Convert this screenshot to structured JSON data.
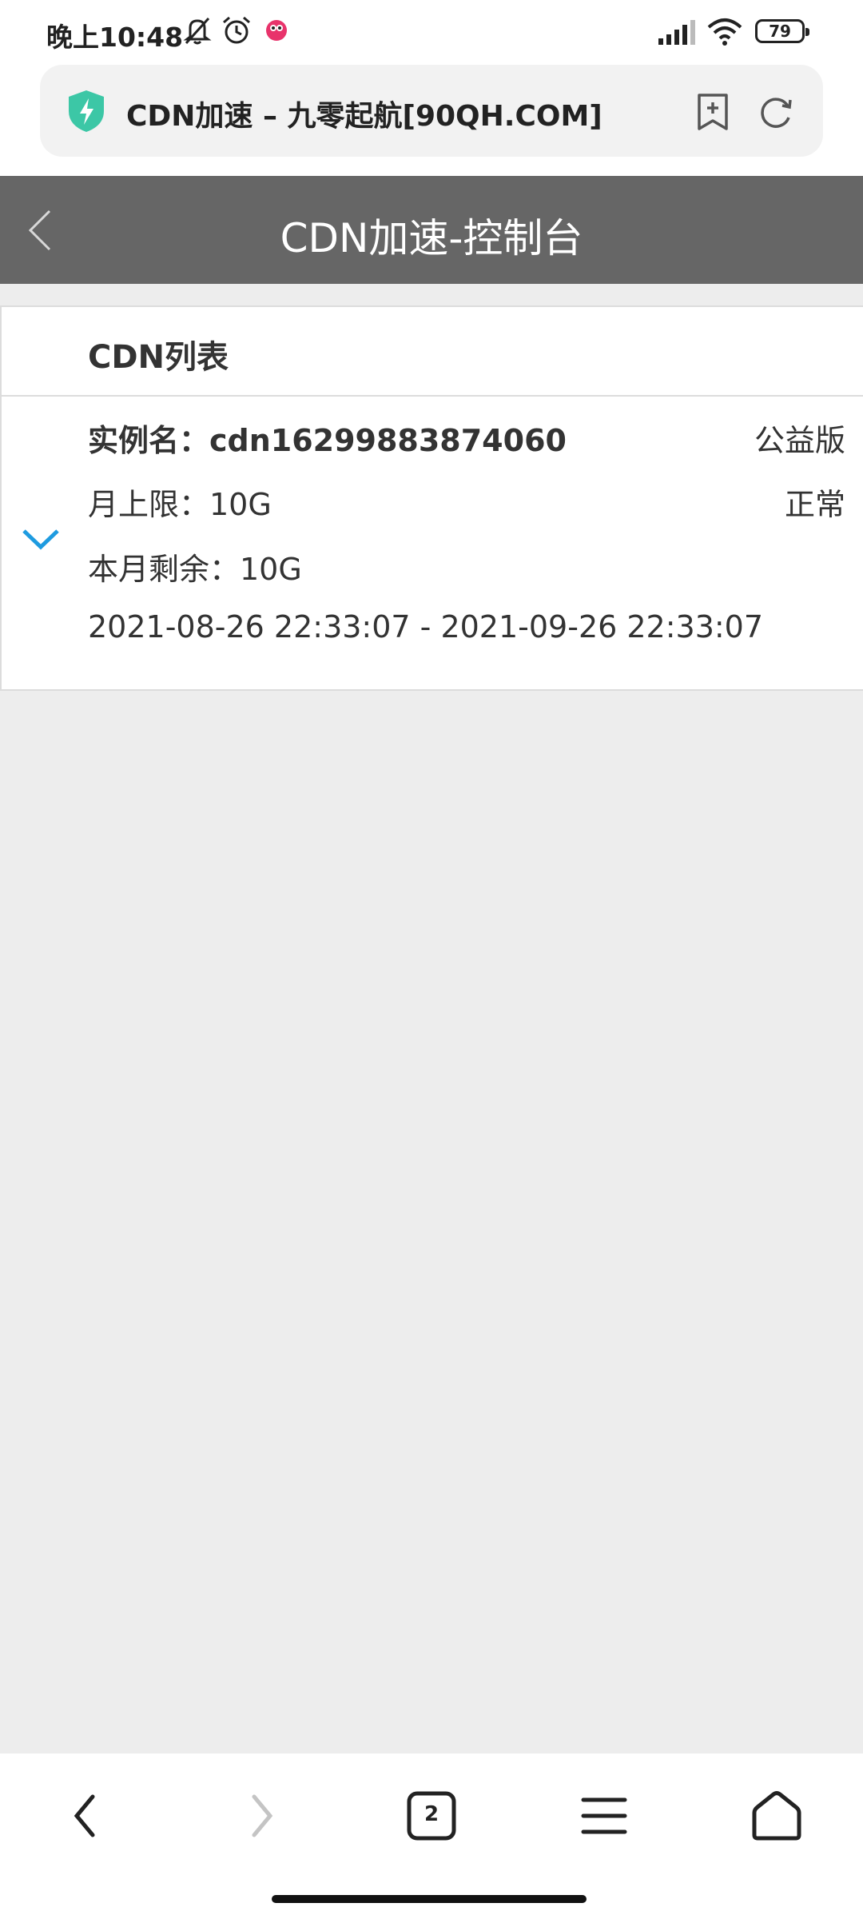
{
  "status_bar": {
    "time": "晚上10:48",
    "icons": [
      "bell-off-icon",
      "alarm-icon",
      "app-notification-icon",
      "signal-icon",
      "wifi-icon"
    ],
    "battery": "79"
  },
  "browser": {
    "tab_title": "CDN加速 – 九零起航[90QH.COM]",
    "icons": [
      "shield-icon",
      "add-bookmark-icon",
      "reload-icon"
    ],
    "accent_color": "#3cc7a6"
  },
  "header": {
    "title": "CDN加速-控制台",
    "background": "#666666"
  },
  "cdn_list": {
    "title": "CDN列表",
    "items": [
      {
        "name_label": "实例名：cdn16299883874060",
        "monthly_limit": "月上限：10G",
        "remaining": "本月剩余：10G",
        "period": "2021-08-26 22:33:07 - 2021-09-26 22:33:07",
        "edition": "公益版",
        "status": "正常"
      }
    ],
    "chevron_color": "#1e9be0"
  },
  "bottom_nav": {
    "tab_count": "2",
    "icons": [
      "back-icon",
      "forward-icon",
      "tabs-icon",
      "menu-icon",
      "home-icon"
    ]
  }
}
